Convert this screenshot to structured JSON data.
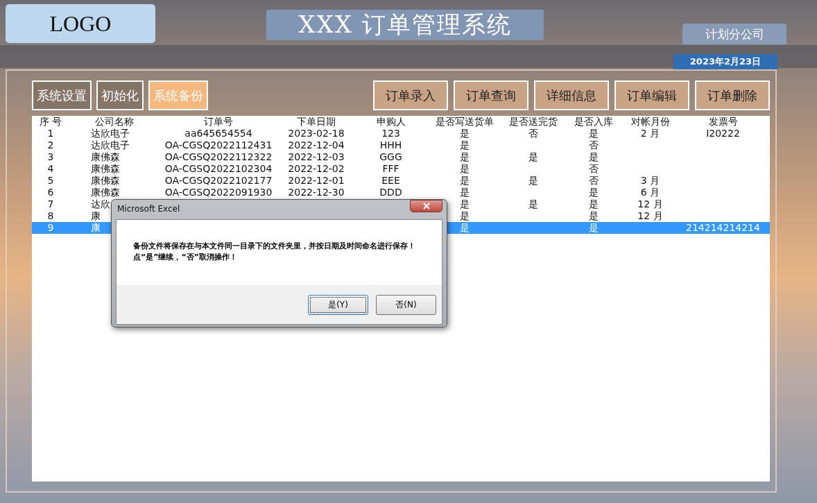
{
  "header": {
    "logo": "LOGO",
    "title": "XXX 订单管理系统",
    "company": "计划分公司",
    "date": "2023年2月23日"
  },
  "left_buttons": [
    {
      "label": "系统设置",
      "selected": false
    },
    {
      "label": "初始化",
      "selected": false
    },
    {
      "label": "系统备份",
      "selected": true
    }
  ],
  "right_buttons": [
    "订单录入",
    "订单查询",
    "详细信息",
    "订单编辑",
    "订单删除"
  ],
  "table": {
    "columns": [
      "序 号",
      "公司名称",
      "订单号",
      "下单日期",
      "申购人",
      "是否写送货单",
      "是否送完货",
      "是否入库",
      "对帐月份",
      "发票号"
    ],
    "rows": [
      {
        "no": "1",
        "company": "达欣电子",
        "order_no": "aa645654554",
        "date": "2023-02-18",
        "buyer": "123",
        "delivery_note": "是",
        "delivered": "否",
        "stocked": "是",
        "month": "2 月",
        "invoice": "I20222",
        "selected": false
      },
      {
        "no": "2",
        "company": "达欣电子",
        "order_no": "OA-CGSQ2022112431",
        "date": "2022-12-04",
        "buyer": "HHH",
        "delivery_note": "是",
        "stocked": "否",
        "selected": false
      },
      {
        "no": "3",
        "company": "康佛森",
        "order_no": "OA-CGSQ2022112322",
        "date": "2022-12-03",
        "buyer": "GGG",
        "delivery_note": "是",
        "delivered": "是",
        "stocked": "是",
        "selected": false
      },
      {
        "no": "4",
        "company": "康佛森",
        "order_no": "OA-CGSQ2022102304",
        "date": "2022-12-02",
        "buyer": "FFF",
        "delivery_note": "是",
        "stocked": "否",
        "selected": false
      },
      {
        "no": "5",
        "company": "康佛森",
        "order_no": "OA-CGSQ2022102177",
        "date": "2022-12-01",
        "buyer": "EEE",
        "delivery_note": "是",
        "delivered": "是",
        "stocked": "否",
        "month": "3 月",
        "selected": false
      },
      {
        "no": "6",
        "company": "康佛森",
        "order_no": "OA-CGSQ2022091930",
        "date": "2022-12-30",
        "buyer": "DDD",
        "delivery_note": "是",
        "stocked": "是",
        "month": "6 月",
        "selected": false
      },
      {
        "no": "7",
        "company": "达欣",
        "delivery_note": "是",
        "delivered": "是",
        "stocked": "是",
        "month": "12 月",
        "selected": false
      },
      {
        "no": "8",
        "company": "康",
        "delivery_note": "是",
        "stocked": "是",
        "month": "12 月",
        "selected": false
      },
      {
        "no": "9",
        "company": "康",
        "delivery_note": "是",
        "stocked": "是",
        "invoice": "214214214214",
        "selected": true
      }
    ]
  },
  "dialog": {
    "title": "Microsoft Excel",
    "message": "备份文件将保存在与本文件同一目录下的文件夹里，并按日期及时间命名进行保存！点“是”继续，“否”取消操作！",
    "buttons": [
      "是(Y)",
      "否(N)"
    ]
  }
}
